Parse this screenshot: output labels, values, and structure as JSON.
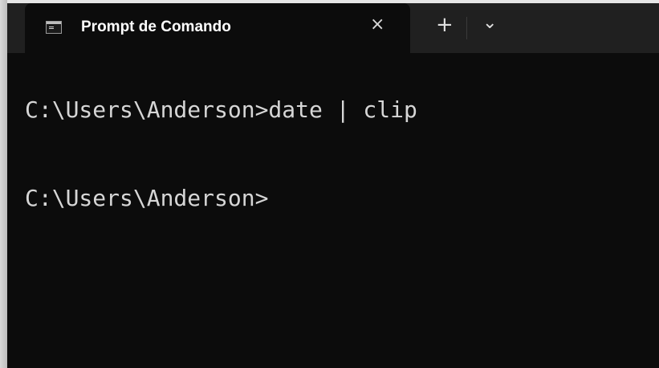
{
  "window": {
    "tab_title": "Prompt de Comando",
    "tab_close_glyph": "×",
    "new_tab_glyph": "+",
    "dropdown_glyph": "⌄",
    "tab_icon": "terminal-icon"
  },
  "terminal": {
    "lines": [
      "C:\\Users\\Anderson>date | clip",
      "C:\\Users\\Anderson>"
    ]
  },
  "colors": {
    "background": "#0c0c0c",
    "titlebar": "#202020",
    "text": "#d6d6d6"
  }
}
